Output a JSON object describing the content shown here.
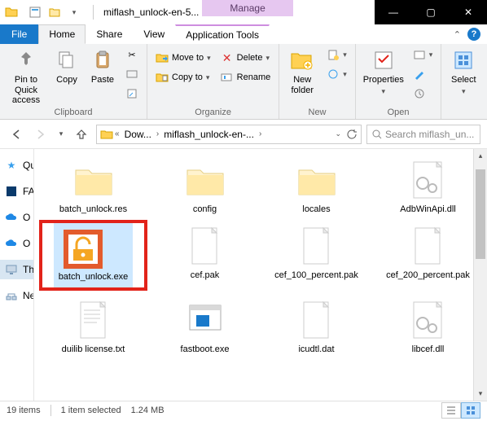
{
  "titlebar": {
    "app_icon": "folder-icon",
    "title": "miflash_unlock-en-5...",
    "contextual_label": "Manage",
    "controls": {
      "min": "—",
      "max": "▢",
      "close": "✕"
    }
  },
  "tabs": {
    "file": "File",
    "items": [
      "Home",
      "Share",
      "View"
    ],
    "contextual": "Application Tools",
    "active_index": 0
  },
  "ribbon": {
    "clipboard": {
      "label": "Clipboard",
      "pin": "Pin to Quick access",
      "copy": "Copy",
      "paste": "Paste"
    },
    "organize": {
      "label": "Organize",
      "move": "Move to",
      "copy": "Copy to",
      "delete": "Delete",
      "rename": "Rename"
    },
    "new": {
      "label": "New",
      "newfolder": "New folder"
    },
    "open": {
      "label": "Open",
      "properties": "Properties"
    },
    "select": {
      "label": "",
      "select": "Select"
    }
  },
  "breadcrumb": {
    "items": [
      "Dow...",
      "miflash_unlock-en-..."
    ]
  },
  "search": {
    "placeholder": "Search miflash_un..."
  },
  "navpane": {
    "items": [
      {
        "icon": "star",
        "label": "Qu"
      },
      {
        "icon": "square-blue",
        "label": "FA"
      },
      {
        "icon": "cloud",
        "label": "O"
      },
      {
        "icon": "cloud",
        "label": "O"
      },
      {
        "icon": "monitor",
        "label": "Th",
        "selected": true
      },
      {
        "icon": "network",
        "label": "Ne"
      }
    ]
  },
  "files": [
    {
      "name": "batch_unlock.res",
      "type": "folder"
    },
    {
      "name": "config",
      "type": "folder"
    },
    {
      "name": "locales",
      "type": "folder"
    },
    {
      "name": "AdbWinApi.dll",
      "type": "dll"
    },
    {
      "name": "batch_unlock.exe",
      "type": "exe-unlock",
      "highlight": true
    },
    {
      "name": "cef.pak",
      "type": "blank"
    },
    {
      "name": "cef_100_percent.pak",
      "type": "blank"
    },
    {
      "name": "cef_200_percent.pak",
      "type": "blank"
    },
    {
      "name": "duilib license.txt",
      "type": "txt"
    },
    {
      "name": "fastboot.exe",
      "type": "exe-generic"
    },
    {
      "name": "icudtl.dat",
      "type": "blank"
    },
    {
      "name": "libcef.dll",
      "type": "dll"
    }
  ],
  "status": {
    "count": "19 items",
    "selection": "1 item selected",
    "size": "1.24 MB"
  }
}
